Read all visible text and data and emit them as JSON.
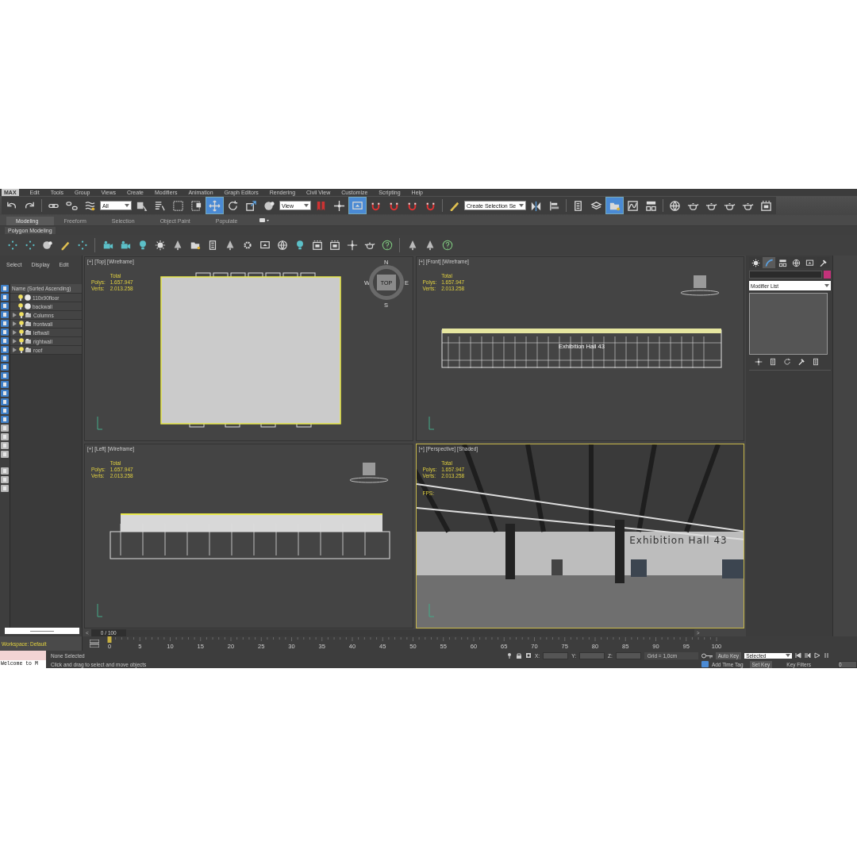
{
  "menu_bar": {
    "logo": "MAX",
    "items": [
      "Edit",
      "Tools",
      "Group",
      "Views",
      "Create",
      "Modifiers",
      "Animation",
      "Graph Editors",
      "Rendering",
      "Civil View",
      "Customize",
      "Scripting",
      "Help"
    ]
  },
  "main_toolbar": [
    {
      "kind": "undo",
      "selected": false
    },
    {
      "kind": "redo",
      "selected": false
    },
    {
      "kind": "sep"
    },
    {
      "kind": "link",
      "selected": false
    },
    {
      "kind": "unlink",
      "selected": false
    },
    {
      "kind": "wave",
      "selected": false
    },
    {
      "kind": "dropdown",
      "value": "All"
    },
    {
      "kind": "pointer",
      "selected": false
    },
    {
      "kind": "list",
      "selected": false
    },
    {
      "kind": "rect",
      "selected": false
    },
    {
      "kind": "window",
      "selected": false
    },
    {
      "kind": "move",
      "selected": true
    },
    {
      "kind": "rotate",
      "selected": false
    },
    {
      "kind": "scale",
      "selected": false
    },
    {
      "kind": "sphere",
      "selected": false
    },
    {
      "kind": "dropdown",
      "value": "View"
    },
    {
      "kind": "bookmark",
      "selected": false
    },
    {
      "kind": "cross",
      "selected": false
    },
    {
      "kind": "monitor",
      "selected": true
    },
    {
      "kind": "magnet",
      "selected": false
    },
    {
      "kind": "magnet",
      "selected": false
    },
    {
      "kind": "magnet",
      "selected": false
    },
    {
      "kind": "magnet",
      "selected": false
    },
    {
      "kind": "sep"
    },
    {
      "kind": "pencil",
      "selected": false
    },
    {
      "kind": "dropdown",
      "value": "Create Selection Se"
    },
    {
      "kind": "mirror",
      "selected": false
    },
    {
      "kind": "align",
      "selected": false
    },
    {
      "kind": "sep"
    },
    {
      "kind": "doc",
      "selected": false
    },
    {
      "kind": "layers",
      "selected": false
    },
    {
      "kind": "folder",
      "selected": true
    },
    {
      "kind": "graph",
      "selected": false
    },
    {
      "kind": "schematic",
      "selected": false
    },
    {
      "kind": "sep"
    },
    {
      "kind": "globe",
      "selected": false
    },
    {
      "kind": "teapot",
      "selected": false
    },
    {
      "kind": "teapot",
      "selected": false
    },
    {
      "kind": "teapot",
      "selected": false
    },
    {
      "kind": "teapot",
      "selected": false
    },
    {
      "kind": "frame",
      "selected": false
    }
  ],
  "ribbon": {
    "tabs": [
      {
        "label": "Modeling",
        "selected": true
      },
      {
        "label": "Freeform",
        "selected": false
      },
      {
        "label": "Selection",
        "selected": false
      },
      {
        "label": "Object Paint",
        "selected": false
      },
      {
        "label": "Populate",
        "selected": false
      }
    ],
    "panel": "Polygon Modeling"
  },
  "explorer_toolbar": [
    {
      "kind": "dots"
    },
    {
      "kind": "dots"
    },
    {
      "kind": "sphere"
    },
    {
      "kind": "pencil"
    },
    {
      "kind": "dots"
    },
    {
      "kind": "sep"
    },
    {
      "kind": "camera"
    },
    {
      "kind": "camera"
    },
    {
      "kind": "bulb"
    },
    {
      "kind": "sun"
    },
    {
      "kind": "tree"
    },
    {
      "kind": "folder"
    },
    {
      "kind": "doc"
    },
    {
      "kind": "tree"
    },
    {
      "kind": "gear"
    },
    {
      "kind": "monitor"
    },
    {
      "kind": "globe"
    },
    {
      "kind": "bulb"
    },
    {
      "kind": "frame"
    },
    {
      "kind": "frame"
    },
    {
      "kind": "cross"
    },
    {
      "kind": "teapot"
    },
    {
      "kind": "help"
    },
    {
      "kind": "sep"
    },
    {
      "kind": "tree"
    },
    {
      "kind": "tree"
    },
    {
      "kind": "help"
    }
  ],
  "scene_explorer": {
    "menu": [
      "Select",
      "Display",
      "Edit"
    ],
    "column": "Name (Sorted Ascending)",
    "rows": [
      {
        "name": "110x90floor",
        "kind": "object"
      },
      {
        "name": "backwall",
        "kind": "object"
      },
      {
        "name": "Columns",
        "kind": "group",
        "expanded": false
      },
      {
        "name": "frontwall",
        "kind": "group",
        "expanded": false
      },
      {
        "name": "leftwall",
        "kind": "group",
        "expanded": false
      },
      {
        "name": "rightwall",
        "kind": "group",
        "expanded": false
      },
      {
        "name": "roof",
        "kind": "group",
        "expanded": false
      }
    ],
    "workspace": "Workspace: Default"
  },
  "viewports": [
    {
      "label": "[+] [Top] [Wireframe]",
      "kind": "top",
      "active": false,
      "stats": [
        "Total",
        "Polys:",
        "1.657.947",
        "Verts:",
        "2.013.258"
      ],
      "compass": [
        "N",
        "W",
        "E",
        "S"
      ],
      "cube_label": "TOP"
    },
    {
      "label": "[+] [Front] [Wireframe]",
      "kind": "front",
      "active": false,
      "stats": [
        "Total",
        "Polys:",
        "1.657.947",
        "Verts:",
        "2.013.258"
      ],
      "scene_text": "Exhibition Hall 43"
    },
    {
      "label": "[+] [Left] [Wireframe]",
      "kind": "left",
      "active": false,
      "stats": [
        "Total",
        "Polys:",
        "1.657.947",
        "Verts:",
        "2.013.258"
      ]
    },
    {
      "label": "[+] [Perspective] [Shaded]",
      "kind": "perspective",
      "active": true,
      "stats": [
        "Total",
        "Polys:",
        "1.657.947",
        "Verts:",
        "2.013.258"
      ],
      "fps": "FPS:",
      "scene_text": "Exhibition Hall 43"
    }
  ],
  "command_panel": {
    "tabs": [
      {
        "kind": "sun",
        "selected": false
      },
      {
        "kind": "curve",
        "selected": true
      },
      {
        "kind": "schematic",
        "selected": false
      },
      {
        "kind": "globe",
        "selected": false
      },
      {
        "kind": "monitor",
        "selected": false
      },
      {
        "kind": "hammer",
        "selected": false
      }
    ],
    "color": "#c2327a",
    "modifier_list": "Modifier List"
  },
  "time_slider": {
    "position": "0 / 100",
    "level": 0,
    "prev": "<",
    "next": ">"
  },
  "track_bar": {
    "labels": [
      "0",
      "5",
      "10",
      "15",
      "20",
      "25",
      "30",
      "35",
      "40",
      "45",
      "50",
      "55",
      "60",
      "65",
      "70",
      "75",
      "80",
      "85",
      "90",
      "95",
      "100"
    ]
  },
  "status_bar": {
    "listener": "Welcome to M",
    "selection": "None Selected",
    "prompt": "Click and drag to select and move objects",
    "x_label": "X:",
    "y_label": "Y:",
    "z_label": "Z:",
    "grid": "Grid = 1,0cm",
    "add_time_tag": "Add Time Tag",
    "auto_key": "Auto Key",
    "key_mode": "Selected",
    "set_key": "Set Key",
    "key_filters": "Key Filters",
    "frame": "0"
  }
}
